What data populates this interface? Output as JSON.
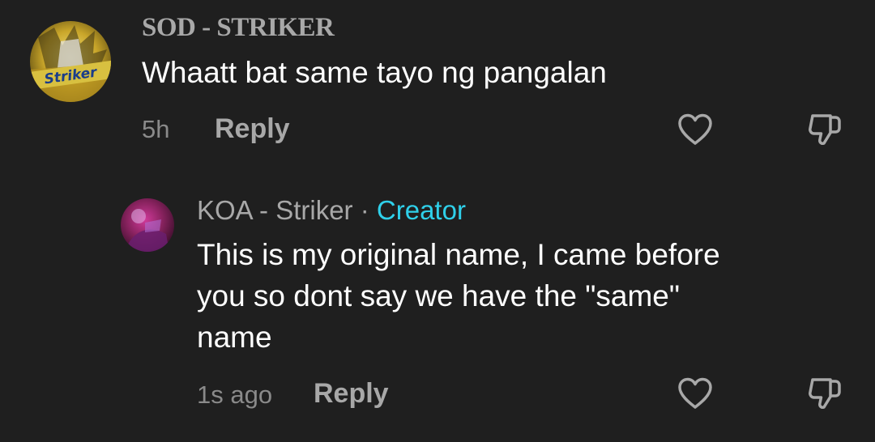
{
  "comments": [
    {
      "username": "SOD - STRIKER",
      "avatar_text": "Striker",
      "text": "Whaatt bat same tayo ng pangalan",
      "time": "5h",
      "reply_label": "Reply"
    }
  ],
  "replies": [
    {
      "username": "KOA - Striker",
      "separator": "·",
      "badge": "Creator",
      "text_lines": [
        "This is my original name, I came before",
        "you so dont say we have the \"same\"",
        "name"
      ],
      "time": "1s ago",
      "reply_label": "Reply"
    }
  ],
  "colors": {
    "background": "#1f1f1f",
    "username": "#a8a8a8",
    "creator_badge": "#2fd0ea",
    "body_text": "#ffffff",
    "meta": "#8a8a8a"
  },
  "icons": [
    "heart-icon",
    "dislike-icon"
  ]
}
